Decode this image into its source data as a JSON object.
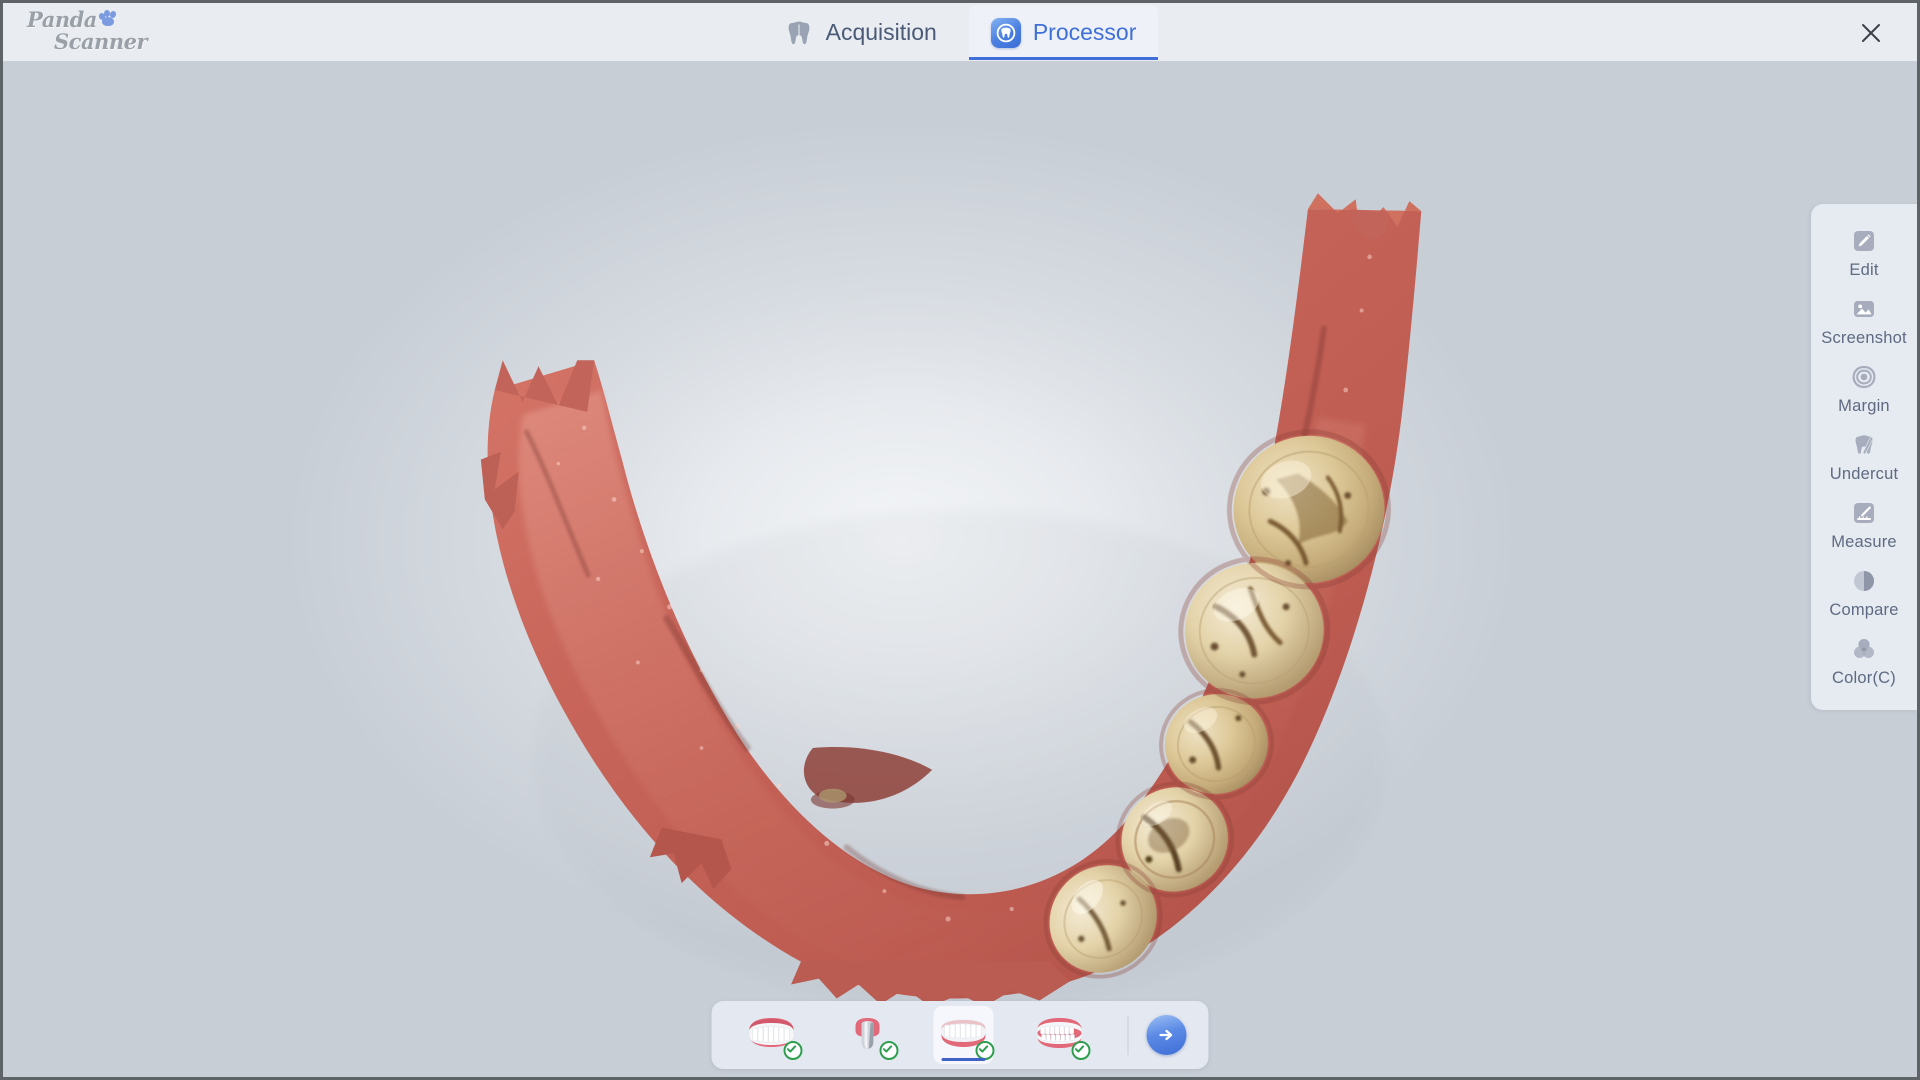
{
  "app": {
    "logo_line1": "Panda",
    "logo_line2": "Scanner",
    "logo_icon": "paw-print-icon"
  },
  "header": {
    "tabs": [
      {
        "label": "Acquisition",
        "icon": "tooth-icon",
        "active": false
      },
      {
        "label": "Processor",
        "icon": "tooth-in-circle-icon",
        "active": true
      }
    ],
    "close_label": "✕",
    "close_icon": "close-icon"
  },
  "toolbar": {
    "items": [
      {
        "label": "Edit",
        "icon": "pencil-square-icon"
      },
      {
        "label": "Screenshot",
        "icon": "image-icon"
      },
      {
        "label": "Margin",
        "icon": "concentric-rings-icon"
      },
      {
        "label": "Undercut",
        "icon": "tooth-slash-icon"
      },
      {
        "label": "Measure",
        "icon": "ruler-pencil-icon"
      },
      {
        "label": "Compare",
        "icon": "half-circle-contrast-icon"
      },
      {
        "label": "Color(C)",
        "icon": "three-circles-color-icon"
      }
    ]
  },
  "thumbbar": {
    "items": [
      {
        "name": "upper-arch",
        "icon": "upper-jaw-icon",
        "status": "complete",
        "selected": false
      },
      {
        "name": "preparation",
        "icon": "prepared-tooth-icon",
        "status": "complete",
        "selected": false
      },
      {
        "name": "lower-arch",
        "icon": "lower-jaw-icon",
        "status": "complete",
        "selected": true
      },
      {
        "name": "bite",
        "icon": "occlusion-icon",
        "status": "complete",
        "selected": false
      }
    ],
    "next_icon": "arrow-right-icon",
    "check_icon": "check-circle-icon"
  },
  "viewport": {
    "model_name": "mandibular-arch-3d-scan",
    "model_description": "Lower dental arch intraoral scan with gingiva and five posterior teeth"
  },
  "colors": {
    "accent": "#3f6fd8",
    "header_bg": "#e9edf2",
    "panel_bg": "#e6eaf1",
    "text": "#5f6b82",
    "status_ok": "#2e9e4f",
    "gingiva": "#c9695d",
    "enamel": "#e3d0a8"
  }
}
